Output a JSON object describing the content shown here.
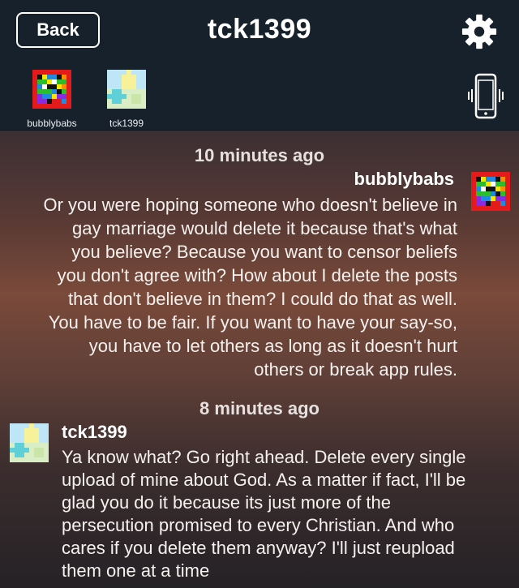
{
  "header": {
    "back_label": "Back",
    "title": "tck1399",
    "settings_icon": "gear-icon",
    "phone_icon": "phone-vibrate-icon"
  },
  "participants": [
    {
      "name": "bubblybabs",
      "avatar": "rainbow-pixel-avatar"
    },
    {
      "name": "tck1399",
      "avatar": "sun-landscape-pixel-avatar"
    }
  ],
  "messages": [
    {
      "timestamp": "10 minutes ago",
      "sender": "bubblybabs",
      "align": "right",
      "lines": [
        "Or you were hoping someone who doesn't believe in",
        "gay marriage would delete it because that's what",
        "you believe?  Because you want to censor beliefs",
        "you don't agree with?  How about I delete the posts",
        "that don't believe in them?  I could do that as well.",
        "You have to be fair.  If you want to have your say-so,",
        "you have to let others as long as it doesn't hurt",
        "others or break app rules."
      ]
    },
    {
      "timestamp": "8 minutes ago",
      "sender": "tck1399",
      "align": "left",
      "lines": [
        "Ya know what? Go right ahead. Delete every single",
        "upload of mine about God. As a matter if fact, I'll be",
        "glad you do it because its just more of the",
        "persecution promised to every Christian. And who",
        "cares if you delete them anyway? I'll just reupload",
        "them one at a time"
      ]
    }
  ],
  "colors": {
    "header_bg": "#17212b",
    "text": "#ffffff",
    "timestamp": "#e6e1df"
  }
}
